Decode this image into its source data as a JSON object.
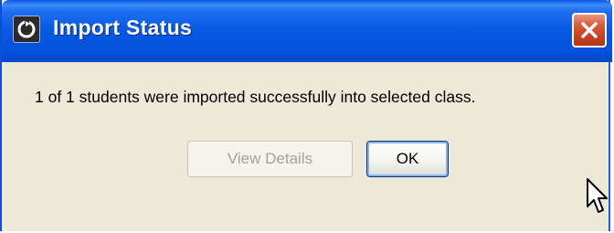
{
  "dialog": {
    "title": "Import Status",
    "message": "1 of 1 students were imported successfully into selected class.",
    "buttons": {
      "view_details_label": "View Details",
      "ok_label": "OK"
    },
    "icons": {
      "title": "app-icon",
      "close": "close-icon",
      "cursor": "mouse-pointer-icon"
    },
    "colors": {
      "titlebar": "#0658e3",
      "close_button": "#d9593a",
      "body": "#ece9d8",
      "disabled_text": "#a6a496"
    },
    "state": {
      "view_details_enabled": false,
      "ok_focused": true
    }
  }
}
